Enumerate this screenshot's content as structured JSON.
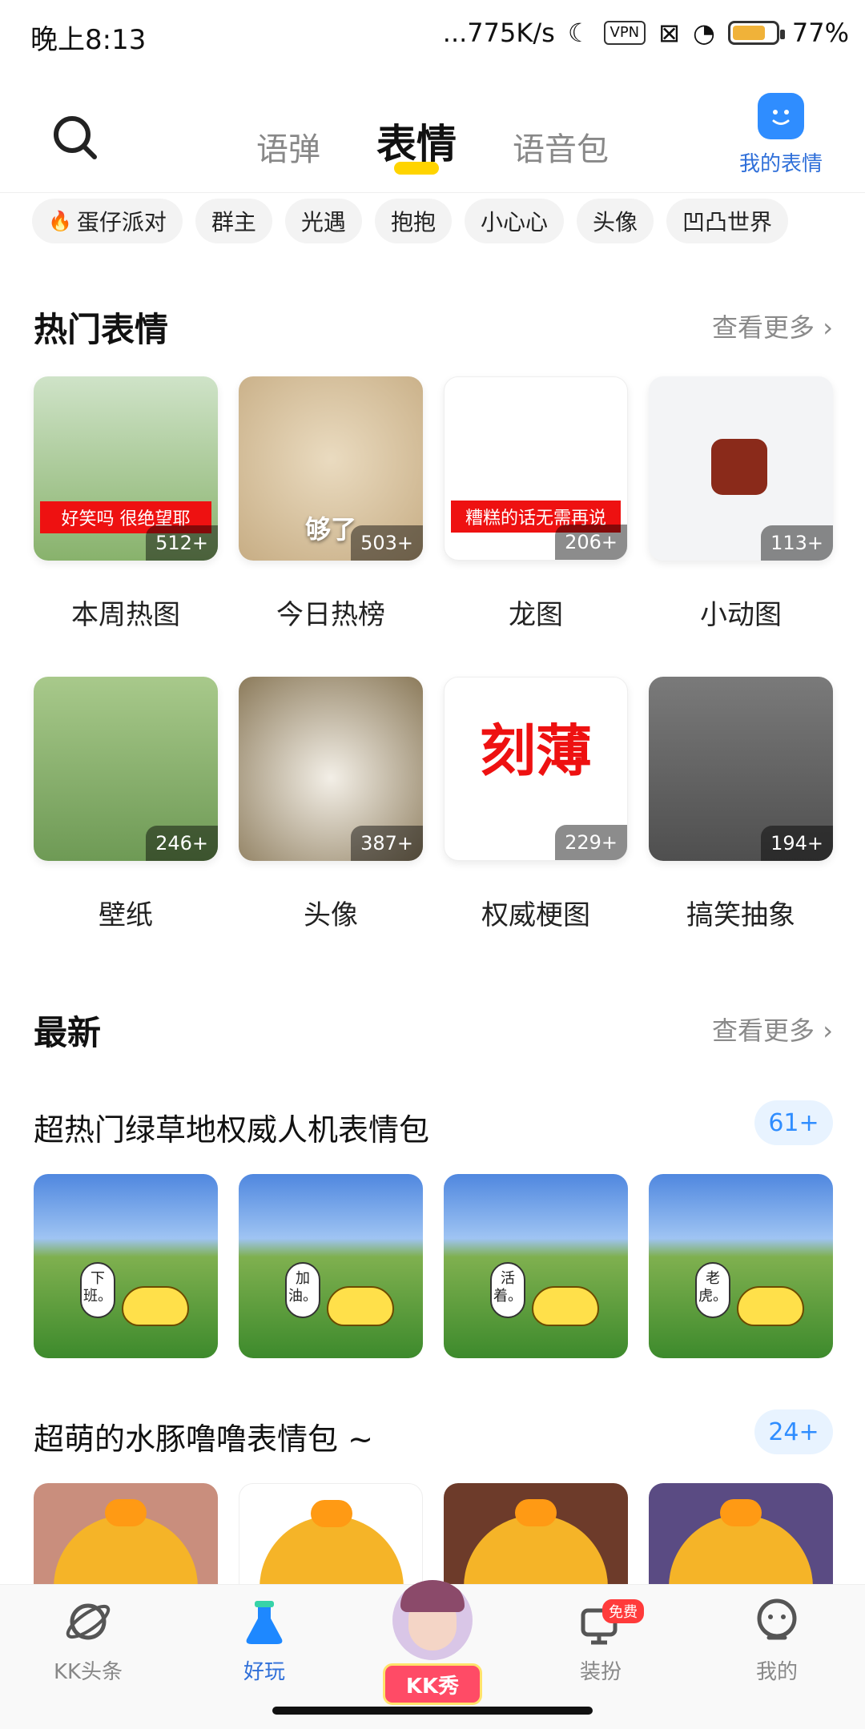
{
  "status_bar": {
    "time": "晚上8:13",
    "network_speed": "...775K/s",
    "vpn": "VPN",
    "battery": "77%",
    "battery_level": 0.77
  },
  "header": {
    "tabs": [
      "语弹",
      "表情",
      "语音包"
    ],
    "active_tab": "表情",
    "my_emoji_label": "我的表情"
  },
  "chips": [
    "蛋仔派对",
    "群主",
    "光遇",
    "抱抱",
    "小心心",
    "头像",
    "凹凸世界"
  ],
  "hot": {
    "title": "热门表情",
    "more": "查看更多",
    "items": [
      {
        "label": "本周热图",
        "count": "512+",
        "overlay": "好笑吗 很绝望耶"
      },
      {
        "label": "今日热榜",
        "count": "503+",
        "overlay": "够了"
      },
      {
        "label": "龙图",
        "count": "206+",
        "overlay": "糟糕的话无需再说"
      },
      {
        "label": "小动图",
        "count": "113+",
        "overlay": ""
      },
      {
        "label": "壁纸",
        "count": "246+",
        "overlay": ""
      },
      {
        "label": "头像",
        "count": "387+",
        "overlay": ""
      },
      {
        "label": "权威梗图",
        "count": "229+",
        "overlay": "刻薄"
      },
      {
        "label": "搞笑抽象",
        "count": "194+",
        "overlay": ""
      }
    ]
  },
  "latest": {
    "title": "最新",
    "more": "查看更多",
    "packs": [
      {
        "title": "超热门绿草地权威人机表情包",
        "count": "61+",
        "stickers": [
          "下班。",
          "加油。",
          "活着。",
          "老虎。"
        ]
      },
      {
        "title": "超萌的水豚噜噜表情包 ~",
        "count": "24+",
        "stickers": [
          "",
          "",
          "",
          ""
        ]
      }
    ]
  },
  "bottom_nav": {
    "items": [
      "KK头条",
      "好玩",
      "KK秀",
      "装扮",
      "我的"
    ],
    "active": "好玩",
    "free_badge": "免费"
  }
}
